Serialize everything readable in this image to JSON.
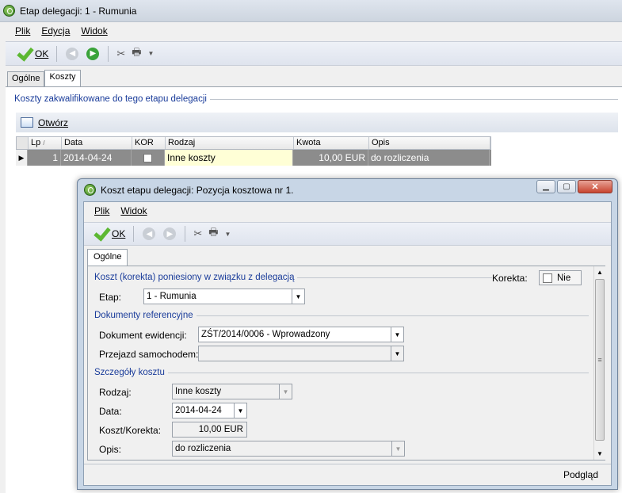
{
  "main_window": {
    "title": "Etap delegacji: 1 - Rumunia",
    "menu": [
      "Plik",
      "Edycja",
      "Widok"
    ],
    "toolbar": {
      "ok_label": "OK"
    },
    "tabs": [
      "Ogólne",
      "Koszty"
    ],
    "section_title": "Koszty zakwalifikowane do tego etapu delegacji",
    "open_label": "Otwórz",
    "grid": {
      "columns": [
        "Lp",
        "Data",
        "KOR",
        "Rodzaj",
        "Kwota",
        "Opis"
      ],
      "rows": [
        {
          "lp": "1",
          "data": "2014-04-24",
          "rodzaj": "Inne koszty",
          "kwota": "10,00 EUR",
          "opis": "do rozliczenia"
        }
      ]
    }
  },
  "dialog": {
    "title": "Koszt etapu delegacji: Pozycja kosztowa nr 1.",
    "menu": [
      "Plik",
      "Widok"
    ],
    "toolbar": {
      "ok_label": "OK"
    },
    "tabs": [
      "Ogólne"
    ],
    "section1": "Koszt (korekta) poniesiony w związku z delegacją",
    "korekta_label": "Korekta:",
    "korekta_value": "Nie",
    "etap_label": "Etap:",
    "etap_value": "1 - Rumunia",
    "section2": "Dokumenty referencyjne",
    "dokument_label": "Dokument ewidencji:",
    "dokument_value": "ZŚT/2014/0006 - Wprowadzony",
    "przejazd_label": "Przejazd samochodem:",
    "przejazd_value": "",
    "section3": "Szczegóły kosztu",
    "rodzaj_label": "Rodzaj:",
    "rodzaj_value": "Inne koszty",
    "data_label": "Data:",
    "data_value": "2014-04-24",
    "koszt_label": "Koszt/Korekta:",
    "koszt_value": "10,00 EUR",
    "opis_label": "Opis:",
    "opis_value": "do rozliczenia",
    "status_label": "Podgląd"
  }
}
